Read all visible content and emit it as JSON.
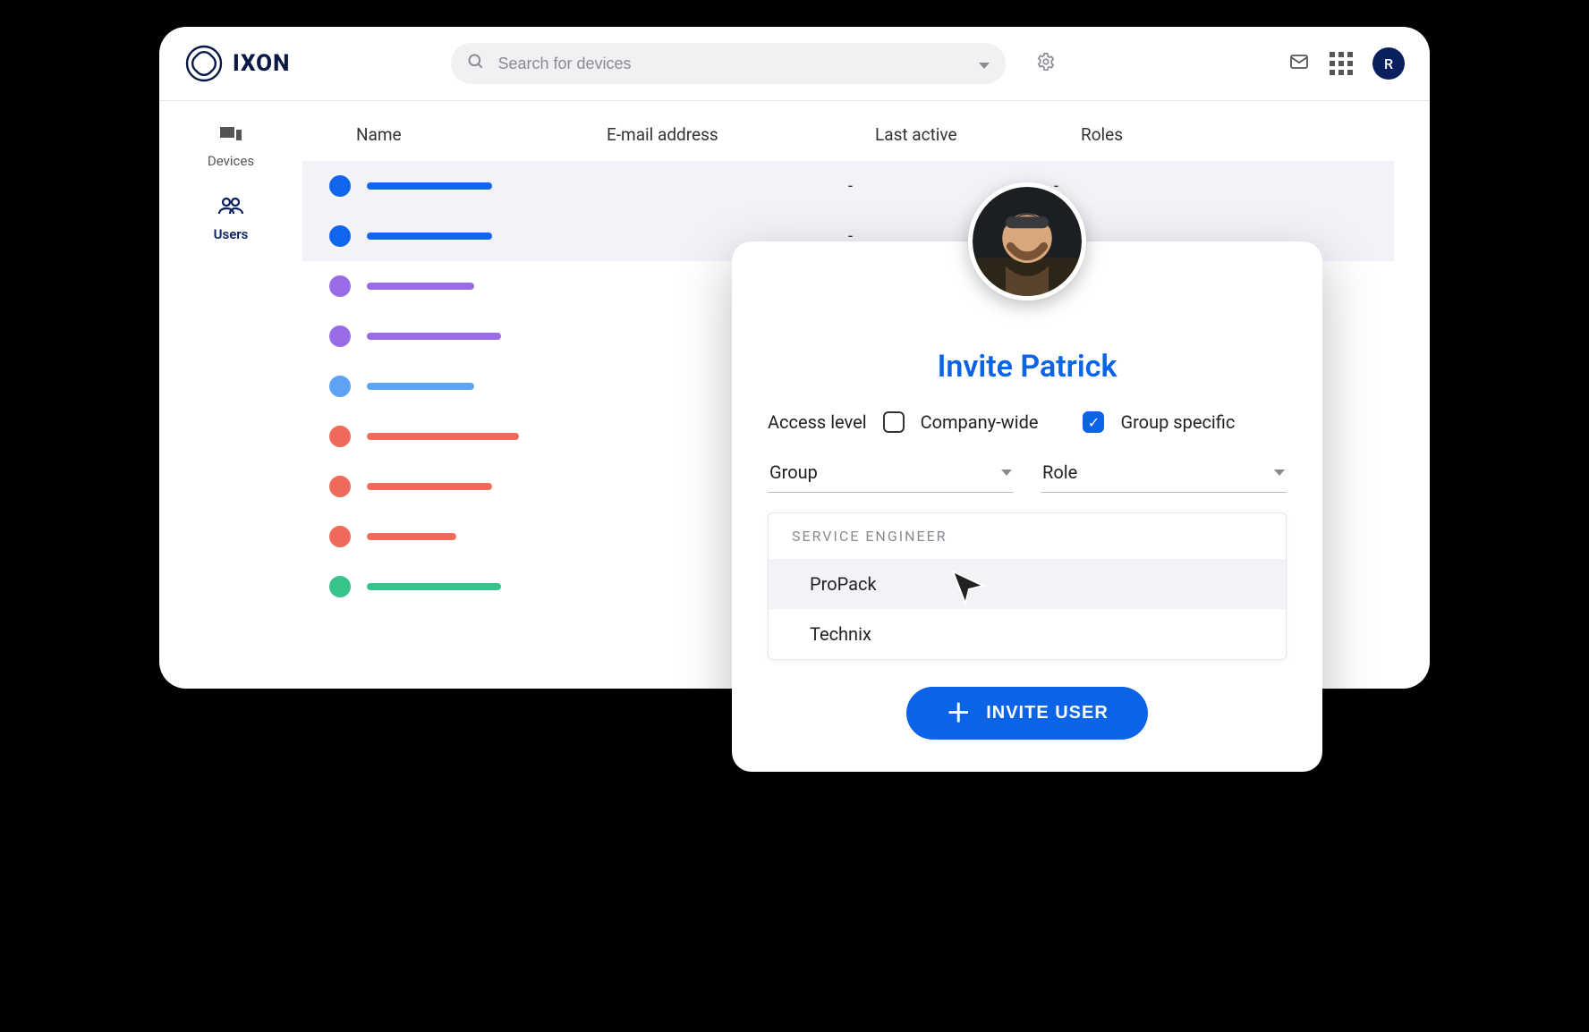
{
  "brand": {
    "name": "IXON"
  },
  "search": {
    "placeholder": "Search for devices"
  },
  "avatar_initial": "R",
  "sidebar": {
    "items": [
      {
        "label": "Devices"
      },
      {
        "label": "Users"
      }
    ]
  },
  "table": {
    "headers": {
      "name": "Name",
      "email": "E-mail address",
      "last": "Last active",
      "roles": "Roles"
    },
    "rows": [
      {
        "color": "c-blue",
        "name_w": 140,
        "email_w": 220,
        "email_color": "c-blue",
        "last": "-",
        "roles": "-",
        "selected": true
      },
      {
        "color": "c-blue",
        "name_w": 140,
        "email_w": 150,
        "email_color": "c-blue",
        "last": "-",
        "roles": "-",
        "selected": true
      },
      {
        "color": "c-purple",
        "name_w": 120,
        "email_w": 180,
        "email_color": "grey",
        "last": "",
        "roles": "",
        "selected": false
      },
      {
        "color": "c-purple",
        "name_w": 150,
        "email_w": 160,
        "email_color": "grey",
        "last": "",
        "roles": "",
        "selected": false
      },
      {
        "color": "c-lblue",
        "name_w": 120,
        "email_w": 180,
        "email_color": "grey",
        "last": "",
        "roles": "",
        "selected": false
      },
      {
        "color": "c-red",
        "name_w": 170,
        "email_w": 150,
        "email_color": "grey",
        "last": "",
        "roles": "",
        "selected": false
      },
      {
        "color": "c-red",
        "name_w": 140,
        "email_w": 150,
        "email_color": "grey",
        "last": "",
        "roles": "",
        "selected": false
      },
      {
        "color": "c-red",
        "name_w": 100,
        "email_w": 150,
        "email_color": "grey",
        "last": "",
        "roles": "",
        "selected": false
      },
      {
        "color": "c-green",
        "name_w": 150,
        "email_w": 150,
        "email_color": "grey",
        "last": "",
        "roles": "",
        "selected": false
      }
    ]
  },
  "invite": {
    "title": "Invite Patrick",
    "access_label": "Access level",
    "company_wide": "Company-wide",
    "group_specific": "Group specific",
    "group_label": "Group",
    "role_label": "Role",
    "dd_header": "SERVICE ENGINEER",
    "options": [
      {
        "label": "ProPack",
        "hover": true
      },
      {
        "label": "Technix",
        "hover": false
      }
    ],
    "button": "INVITE USER"
  }
}
